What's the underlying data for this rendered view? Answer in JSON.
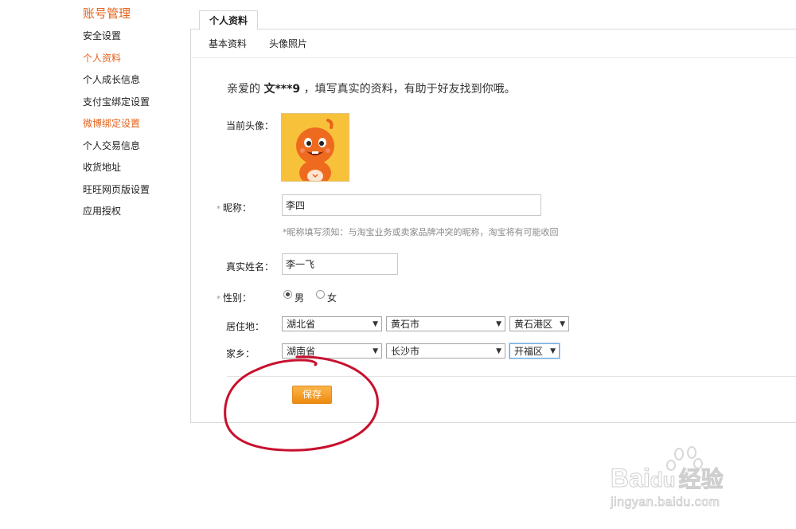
{
  "sidebar": {
    "title": "账号管理",
    "items": [
      {
        "label": "安全设置"
      },
      {
        "label": "个人资料"
      },
      {
        "label": "个人成长信息"
      },
      {
        "label": "支付宝绑定设置"
      },
      {
        "label": "微博绑定设置"
      },
      {
        "label": "个人交易信息"
      },
      {
        "label": "收货地址"
      },
      {
        "label": "旺旺网页版设置"
      },
      {
        "label": "应用授权"
      }
    ]
  },
  "main_tab": "个人资料",
  "sub_tabs": [
    "基本资料",
    "头像照片"
  ],
  "greeting": {
    "prefix": "亲爱的",
    "username": "文***9",
    "suffix": "，填写真实的资料，有助于好友找到你哦。"
  },
  "form": {
    "avatar_label": "当前头像：",
    "required_mark": "*",
    "nickname_label": "昵称：",
    "nickname_value": "李四",
    "nickname_hint": "*昵称填写须知：与淘宝业务或卖家品牌冲突的昵称，淘宝将有可能收回",
    "realname_label": "真实姓名：",
    "realname_value": "李一飞",
    "gender_label": "性别：",
    "gender_options": [
      "男",
      "女"
    ],
    "gender_selected": "男",
    "residence_label": "居住地：",
    "residence": {
      "province": "湖北省",
      "city": "黄石市",
      "district": "黄石港区"
    },
    "hometown_label": "家乡：",
    "hometown": {
      "province": "湖南省",
      "city": "长沙市",
      "district": "开福区"
    },
    "save_label": "保存"
  },
  "watermark": {
    "brand": "Bai",
    "brand2": "du",
    "cn": "经验",
    "url": "jingyan.baidu.com"
  },
  "colors": {
    "accent": "#e4621a",
    "button": "#f39c1f",
    "annotation": "#c8102e"
  }
}
